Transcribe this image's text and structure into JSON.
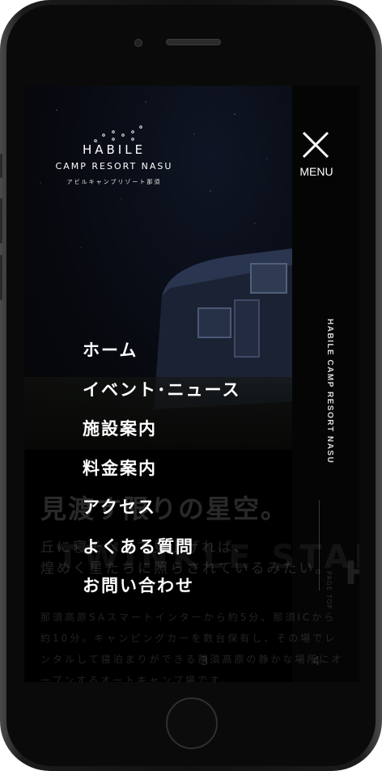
{
  "brand": {
    "logo_line1": "HABILE",
    "logo_line2": "CAMP RESORT NASU",
    "logo_kana": "アビルキャンプリゾート那須",
    "vertical_text": "HABILE CAMP RESORT NASU"
  },
  "menu_toggle": {
    "label": "MENU",
    "icon": "close-icon"
  },
  "nav": {
    "items": [
      {
        "label": "ホーム"
      },
      {
        "label": "イベント･ニュース"
      },
      {
        "label": "施設案内"
      },
      {
        "label": "料金案内"
      },
      {
        "label": "アクセス"
      },
      {
        "label": "よくある質問"
      },
      {
        "label": "お問い合わせ"
      }
    ]
  },
  "background": {
    "title": "見渡す限りの星空。",
    "subtitle_line1": "丘に寝そべって見上げれば、",
    "subtitle_line2": "煌めく星たちに照らされているみたい。",
    "body": "那須高原SAスマートインターから約5分、那須ICから約10分。キャンピングカーを数台保有し、その場でレンタルして寝泊まりができる那須高原の静かな場所にオープンするオートキャンプ場です。",
    "big_text": "TWINKLE STARS",
    "page_top": "PAGE TOP",
    "page_num_left": "3",
    "page_num_right": "4"
  },
  "colors": {
    "background": "#000000",
    "text": "#ffffff",
    "device_frame": "#111111"
  }
}
